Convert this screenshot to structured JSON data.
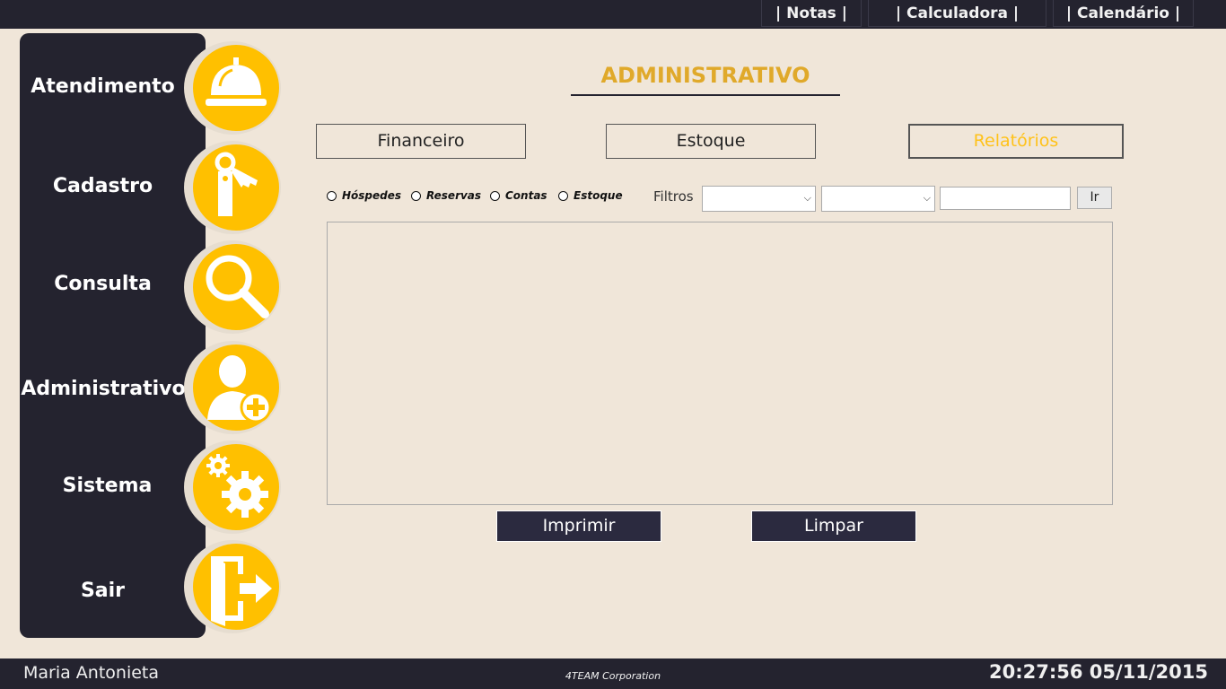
{
  "topbar": {
    "links": [
      {
        "label": "| Notas |"
      },
      {
        "label": "| Calculadora |"
      },
      {
        "label": "| Calendário |"
      }
    ]
  },
  "sidebar": {
    "items": [
      {
        "label": "Atendimento",
        "icon": "service-bell-icon"
      },
      {
        "label": "Cadastro",
        "icon": "key-tag-icon"
      },
      {
        "label": "Consulta",
        "icon": "magnifier-icon"
      },
      {
        "label": "Administrativo",
        "icon": "user-add-icon"
      },
      {
        "label": "Sistema",
        "icon": "gears-icon"
      },
      {
        "label": "Sair",
        "icon": "exit-door-icon"
      }
    ]
  },
  "main": {
    "title": "ADMINISTRATIVO",
    "tabs": [
      {
        "label": "Financeiro"
      },
      {
        "label": "Estoque"
      },
      {
        "label": "Relatórios",
        "active": true
      }
    ],
    "report_types": [
      {
        "label": "Hóspedes"
      },
      {
        "label": "Reservas"
      },
      {
        "label": "Contas"
      },
      {
        "label": "Estoque"
      }
    ],
    "filters_label": "Filtros",
    "filter_1_value": "",
    "filter_2_value": "",
    "filter_text_value": "",
    "go_label": "Ir",
    "print_label": "Imprimir",
    "clear_label": "Limpar"
  },
  "footer": {
    "user": "Maria Antonieta",
    "company": "4TEAM Corporation",
    "datetime": "20:27:56 05/11/2015"
  },
  "colors": {
    "dark": "#24232f",
    "accent": "#ffc000",
    "background": "#f0e6d9",
    "title": "#e0a92a"
  }
}
